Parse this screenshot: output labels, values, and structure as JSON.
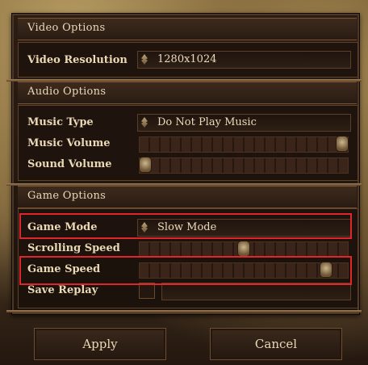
{
  "sections": {
    "video": {
      "title": "Video Options",
      "video_resolution": {
        "label": "Video Resolution",
        "value": "1280x1024"
      }
    },
    "audio": {
      "title": "Audio Options",
      "music_type": {
        "label": "Music Type",
        "value": "Do Not Play Music"
      },
      "music_volume": {
        "label": "Music Volume",
        "level": 1.0
      },
      "sound_volume": {
        "label": "Sound Volume",
        "level": 0.0
      }
    },
    "game": {
      "title": "Game Options",
      "game_mode": {
        "label": "Game Mode",
        "value": "Slow Mode"
      },
      "scrolling_speed": {
        "label": "Scrolling Speed",
        "level": 0.5
      },
      "game_speed": {
        "label": "Game Speed",
        "level": 0.92
      },
      "save_replay": {
        "label": "Save Replay",
        "checked": false
      }
    }
  },
  "buttons": {
    "apply": "Apply",
    "cancel": "Cancel"
  },
  "colors": {
    "highlight": "#e0262b"
  }
}
